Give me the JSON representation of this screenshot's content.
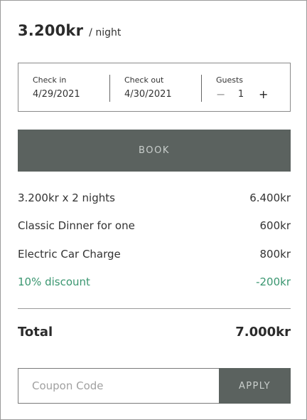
{
  "header": {
    "price": "3.200kr",
    "per_label": "/ night"
  },
  "booking": {
    "check_in": {
      "label": "Check in",
      "value": "4/29/2021"
    },
    "check_out": {
      "label": "Check out",
      "value": "4/30/2021"
    },
    "guests": {
      "label": "Guests",
      "minus": "−",
      "count": "1",
      "plus": "+"
    }
  },
  "book_button": "BOOK",
  "line_items": [
    {
      "label": "3.200kr x 2 nights",
      "amount": "6.400kr"
    },
    {
      "label": "Classic Dinner for one",
      "amount": "600kr"
    },
    {
      "label": "Electric Car Charge",
      "amount": "800kr"
    },
    {
      "label": "10% discount",
      "amount": "-200kr"
    }
  ],
  "total": {
    "label": "Total",
    "amount": "7.000kr"
  },
  "coupon": {
    "placeholder": "Coupon Code",
    "apply_label": "APPLY"
  },
  "colors": {
    "button_bg": "#5b625f",
    "button_text": "#c9cecc",
    "discount": "#3a9670",
    "border": "#9a9a9a"
  }
}
